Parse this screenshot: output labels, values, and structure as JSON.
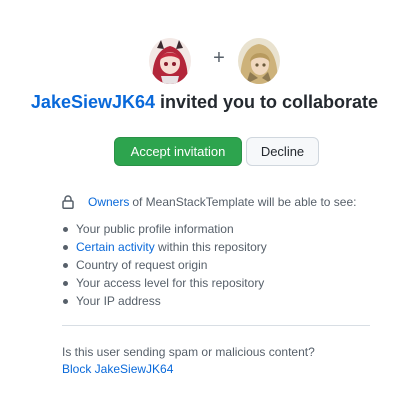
{
  "avatars": {
    "inviter_alt": "JakeSiewJK64",
    "invitee_alt": "invitee",
    "separator": "+"
  },
  "headline": {
    "inviter": "JakeSiewJK64",
    "text": "invited you to collaborate"
  },
  "actions": {
    "accept_label": "Accept invitation",
    "decline_label": "Decline"
  },
  "permissions": {
    "owners_link": "Owners",
    "intro": "of MeanStackTemplate will be able to see:",
    "items": [
      {
        "text": "Your public profile information"
      },
      {
        "link": "Certain activity",
        "text": "within this repository"
      },
      {
        "text": "Country of request origin"
      },
      {
        "text": "Your access level for this repository"
      },
      {
        "text": "Your IP address"
      }
    ]
  },
  "spam": {
    "question": "Is this user sending spam or malicious content?",
    "block_label": "Block JakeSiewJK64"
  },
  "colors": {
    "link": "#0969da",
    "accept_bg": "#2da44e",
    "decline_bg": "#f6f8fa",
    "text_muted": "#57606a"
  }
}
